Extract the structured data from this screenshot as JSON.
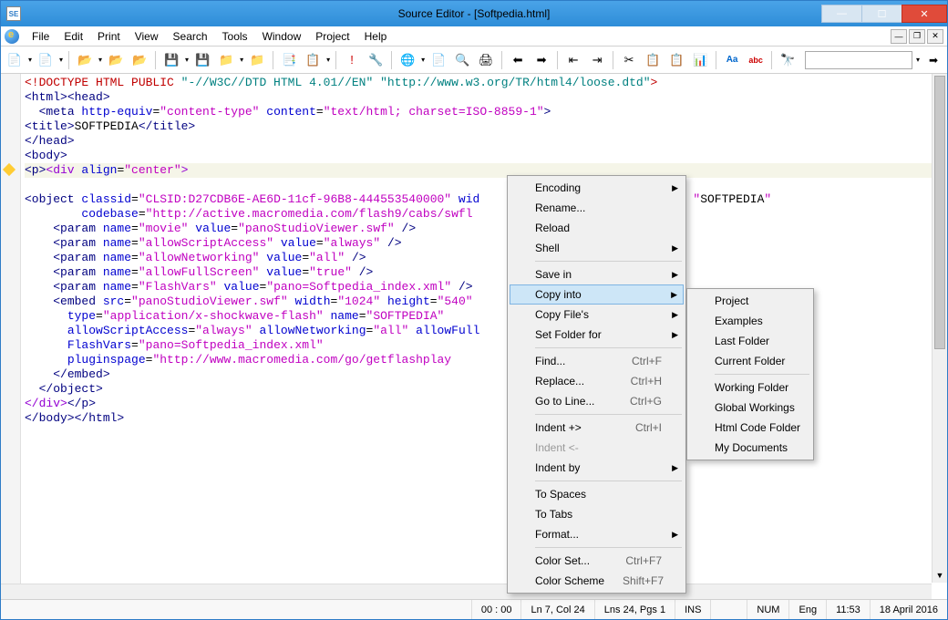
{
  "window": {
    "title": "Source Editor - [Softpedia.html]",
    "app_icon_text": "SE"
  },
  "menus": [
    "File",
    "Edit",
    "Print",
    "View",
    "Search",
    "Tools",
    "Window",
    "Project",
    "Help"
  ],
  "code_lines": [
    {
      "segs": [
        {
          "c": "t-red",
          "t": "<!DOCTYPE HTML PUBLIC "
        },
        {
          "c": "t-teal",
          "t": "\"-//W3C//DTD HTML 4.01//EN\" \"http://www.w3.org/TR/html4/loose.dtd\""
        },
        {
          "c": "t-red",
          "t": ">"
        }
      ]
    },
    {
      "segs": [
        {
          "c": "t-navy",
          "t": "<html>"
        },
        {
          "c": "t-navy",
          "t": "<head>"
        }
      ]
    },
    {
      "segs": [
        {
          "c": "",
          "t": "  "
        },
        {
          "c": "t-navy",
          "t": "<meta "
        },
        {
          "c": "t-blue",
          "t": "http-equiv"
        },
        {
          "c": "",
          "t": "="
        },
        {
          "c": "t-mag",
          "t": "\"content-type\""
        },
        {
          "c": "",
          "t": " "
        },
        {
          "c": "t-blue",
          "t": "content"
        },
        {
          "c": "",
          "t": "="
        },
        {
          "c": "t-mag",
          "t": "\"text/html; charset=ISO-8859-1\""
        },
        {
          "c": "t-navy",
          "t": ">"
        }
      ]
    },
    {
      "segs": [
        {
          "c": "t-navy",
          "t": "<title>"
        },
        {
          "c": "",
          "t": "SOFTPEDIA"
        },
        {
          "c": "t-navy",
          "t": "</title>"
        }
      ]
    },
    {
      "segs": [
        {
          "c": "t-navy",
          "t": "</head>"
        }
      ]
    },
    {
      "segs": [
        {
          "c": "t-navy",
          "t": "<body>"
        }
      ]
    },
    {
      "hl": true,
      "segs": [
        {
          "c": "t-navy",
          "t": "<p>"
        },
        {
          "c": "t-purple",
          "t": "<div "
        },
        {
          "c": "t-blue",
          "t": "align"
        },
        {
          "c": "",
          "t": "="
        },
        {
          "c": "t-mag",
          "t": "\"center\""
        },
        {
          "c": "t-purple",
          "t": ">"
        }
      ]
    },
    {
      "segs": [
        {
          "c": "t-navy",
          "t": "<object "
        },
        {
          "c": "t-blue",
          "t": "classid"
        },
        {
          "c": "",
          "t": "="
        },
        {
          "c": "t-mag",
          "t": "\"CLSID:D27CDB6E-AE6D-11cf-96B8-444553540000\""
        },
        {
          "c": "",
          "t": " "
        },
        {
          "c": "t-blue",
          "t": "wid"
        },
        {
          "c": "",
          "t": "                              "
        },
        {
          "c": "t-mag",
          "t": "\""
        },
        {
          "c": "",
          "t": "SOFTPEDIA"
        },
        {
          "c": "t-mag",
          "t": "\""
        }
      ]
    },
    {
      "segs": [
        {
          "c": "",
          "t": "        "
        },
        {
          "c": "t-blue",
          "t": "codebase"
        },
        {
          "c": "",
          "t": "="
        },
        {
          "c": "t-mag",
          "t": "\"http://active.macromedia.com/flash9/cabs/swfl"
        }
      ]
    },
    {
      "segs": [
        {
          "c": "",
          "t": "    "
        },
        {
          "c": "t-navy",
          "t": "<param "
        },
        {
          "c": "t-blue",
          "t": "name"
        },
        {
          "c": "",
          "t": "="
        },
        {
          "c": "t-mag",
          "t": "\"movie\""
        },
        {
          "c": "",
          "t": " "
        },
        {
          "c": "t-blue",
          "t": "value"
        },
        {
          "c": "",
          "t": "="
        },
        {
          "c": "t-mag",
          "t": "\"panoStudioViewer.swf\""
        },
        {
          "c": "t-navy",
          "t": " />"
        }
      ]
    },
    {
      "segs": [
        {
          "c": "",
          "t": "    "
        },
        {
          "c": "t-navy",
          "t": "<param "
        },
        {
          "c": "t-blue",
          "t": "name"
        },
        {
          "c": "",
          "t": "="
        },
        {
          "c": "t-mag",
          "t": "\"allowScriptAccess\""
        },
        {
          "c": "",
          "t": " "
        },
        {
          "c": "t-blue",
          "t": "value"
        },
        {
          "c": "",
          "t": "="
        },
        {
          "c": "t-mag",
          "t": "\"always\""
        },
        {
          "c": "t-navy",
          "t": " />"
        }
      ]
    },
    {
      "segs": [
        {
          "c": "",
          "t": "    "
        },
        {
          "c": "t-navy",
          "t": "<param "
        },
        {
          "c": "t-blue",
          "t": "name"
        },
        {
          "c": "",
          "t": "="
        },
        {
          "c": "t-mag",
          "t": "\"allowNetworking\""
        },
        {
          "c": "",
          "t": " "
        },
        {
          "c": "t-blue",
          "t": "value"
        },
        {
          "c": "",
          "t": "="
        },
        {
          "c": "t-mag",
          "t": "\"all\""
        },
        {
          "c": "t-navy",
          "t": " />"
        }
      ]
    },
    {
      "segs": [
        {
          "c": "",
          "t": "    "
        },
        {
          "c": "t-navy",
          "t": "<param "
        },
        {
          "c": "t-blue",
          "t": "name"
        },
        {
          "c": "",
          "t": "="
        },
        {
          "c": "t-mag",
          "t": "\"allowFullScreen\""
        },
        {
          "c": "",
          "t": " "
        },
        {
          "c": "t-blue",
          "t": "value"
        },
        {
          "c": "",
          "t": "="
        },
        {
          "c": "t-mag",
          "t": "\"true\""
        },
        {
          "c": "t-navy",
          "t": " />"
        }
      ]
    },
    {
      "segs": [
        {
          "c": "",
          "t": "    "
        },
        {
          "c": "t-navy",
          "t": "<param "
        },
        {
          "c": "t-blue",
          "t": "name"
        },
        {
          "c": "",
          "t": "="
        },
        {
          "c": "t-mag",
          "t": "\"FlashVars\""
        },
        {
          "c": "",
          "t": " "
        },
        {
          "c": "t-blue",
          "t": "value"
        },
        {
          "c": "",
          "t": "="
        },
        {
          "c": "t-mag",
          "t": "\"pano=Softpedia_index.xml\""
        },
        {
          "c": "t-navy",
          "t": " />"
        }
      ]
    },
    {
      "segs": [
        {
          "c": "",
          "t": "    "
        },
        {
          "c": "t-navy",
          "t": "<embed "
        },
        {
          "c": "t-blue",
          "t": "src"
        },
        {
          "c": "",
          "t": "="
        },
        {
          "c": "t-mag",
          "t": "\"panoStudioViewer.swf\""
        },
        {
          "c": "",
          "t": " "
        },
        {
          "c": "t-blue",
          "t": "width"
        },
        {
          "c": "",
          "t": "="
        },
        {
          "c": "t-mag",
          "t": "\"1024\""
        },
        {
          "c": "",
          "t": " "
        },
        {
          "c": "t-blue",
          "t": "height"
        },
        {
          "c": "",
          "t": "="
        },
        {
          "c": "t-mag",
          "t": "\"540\""
        }
      ]
    },
    {
      "segs": [
        {
          "c": "",
          "t": "      "
        },
        {
          "c": "t-blue",
          "t": "type"
        },
        {
          "c": "",
          "t": "="
        },
        {
          "c": "t-mag",
          "t": "\"application/x-shockwave-flash\""
        },
        {
          "c": "",
          "t": " "
        },
        {
          "c": "t-blue",
          "t": "name"
        },
        {
          "c": "",
          "t": "="
        },
        {
          "c": "t-mag",
          "t": "\"SOFTPEDIA\""
        }
      ]
    },
    {
      "segs": [
        {
          "c": "",
          "t": "      "
        },
        {
          "c": "t-blue",
          "t": "allowScriptAccess"
        },
        {
          "c": "",
          "t": "="
        },
        {
          "c": "t-mag",
          "t": "\"always\""
        },
        {
          "c": "",
          "t": " "
        },
        {
          "c": "t-blue",
          "t": "allowNetworking"
        },
        {
          "c": "",
          "t": "="
        },
        {
          "c": "t-mag",
          "t": "\"all\""
        },
        {
          "c": "",
          "t": " "
        },
        {
          "c": "t-blue",
          "t": "allowFull"
        }
      ]
    },
    {
      "segs": [
        {
          "c": "",
          "t": "      "
        },
        {
          "c": "t-blue",
          "t": "FlashVars"
        },
        {
          "c": "",
          "t": "="
        },
        {
          "c": "t-mag",
          "t": "\"pano=Softpedia_index.xml\""
        }
      ]
    },
    {
      "segs": [
        {
          "c": "",
          "t": "      "
        },
        {
          "c": "t-blue",
          "t": "pluginspage"
        },
        {
          "c": "",
          "t": "="
        },
        {
          "c": "t-mag",
          "t": "\"http://www.macromedia.com/go/getflashplay"
        }
      ]
    },
    {
      "segs": [
        {
          "c": "",
          "t": "    "
        },
        {
          "c": "t-navy",
          "t": "</embed>"
        }
      ]
    },
    {
      "segs": [
        {
          "c": "",
          "t": "  "
        },
        {
          "c": "t-navy",
          "t": "</object>"
        }
      ]
    },
    {
      "segs": [
        {
          "c": "t-purple",
          "t": "</div>"
        },
        {
          "c": "t-navy",
          "t": "</p>"
        }
      ]
    },
    {
      "segs": [
        {
          "c": "t-navy",
          "t": "</body>"
        },
        {
          "c": "t-navy",
          "t": "</html>"
        }
      ]
    }
  ],
  "context_menu_1": [
    {
      "label": "Encoding",
      "arrow": true
    },
    {
      "label": "Rename..."
    },
    {
      "label": "Reload"
    },
    {
      "label": "Shell",
      "arrow": true
    },
    {
      "sep": true
    },
    {
      "label": "Save in",
      "arrow": true
    },
    {
      "label": "Copy into",
      "arrow": true,
      "hl": true
    },
    {
      "label": "Copy File's",
      "arrow": true
    },
    {
      "label": "Set Folder for",
      "arrow": true
    },
    {
      "sep": true
    },
    {
      "label": "Find...",
      "shortcut": "Ctrl+F"
    },
    {
      "label": "Replace...",
      "shortcut": "Ctrl+H"
    },
    {
      "label": "Go to Line...",
      "shortcut": "Ctrl+G"
    },
    {
      "sep": true
    },
    {
      "label": "Indent +>",
      "shortcut": "Ctrl+I"
    },
    {
      "label": "Indent <-",
      "disabled": true
    },
    {
      "label": "Indent by",
      "arrow": true
    },
    {
      "sep": true
    },
    {
      "label": "To Spaces"
    },
    {
      "label": "To Tabs"
    },
    {
      "label": "Format...",
      "arrow": true
    },
    {
      "sep": true
    },
    {
      "label": "Color Set...",
      "shortcut": "Ctrl+F7"
    },
    {
      "label": "Color Scheme",
      "shortcut": "Shift+F7"
    }
  ],
  "context_menu_2": [
    {
      "label": "Project"
    },
    {
      "label": "Examples"
    },
    {
      "label": "Last Folder"
    },
    {
      "label": "Current Folder"
    },
    {
      "sep": true
    },
    {
      "label": "Working Folder"
    },
    {
      "label": "Global Workings"
    },
    {
      "label": "Html Code Folder"
    },
    {
      "label": "My Documents"
    }
  ],
  "status": {
    "timer": "00 : 00",
    "pos": "Ln 7, Col 24",
    "sel": "Lns 24, Pgs 1",
    "ins": "INS",
    "num": "NUM",
    "lang": "Eng",
    "time": "11:53",
    "date": "18 April 2016"
  }
}
